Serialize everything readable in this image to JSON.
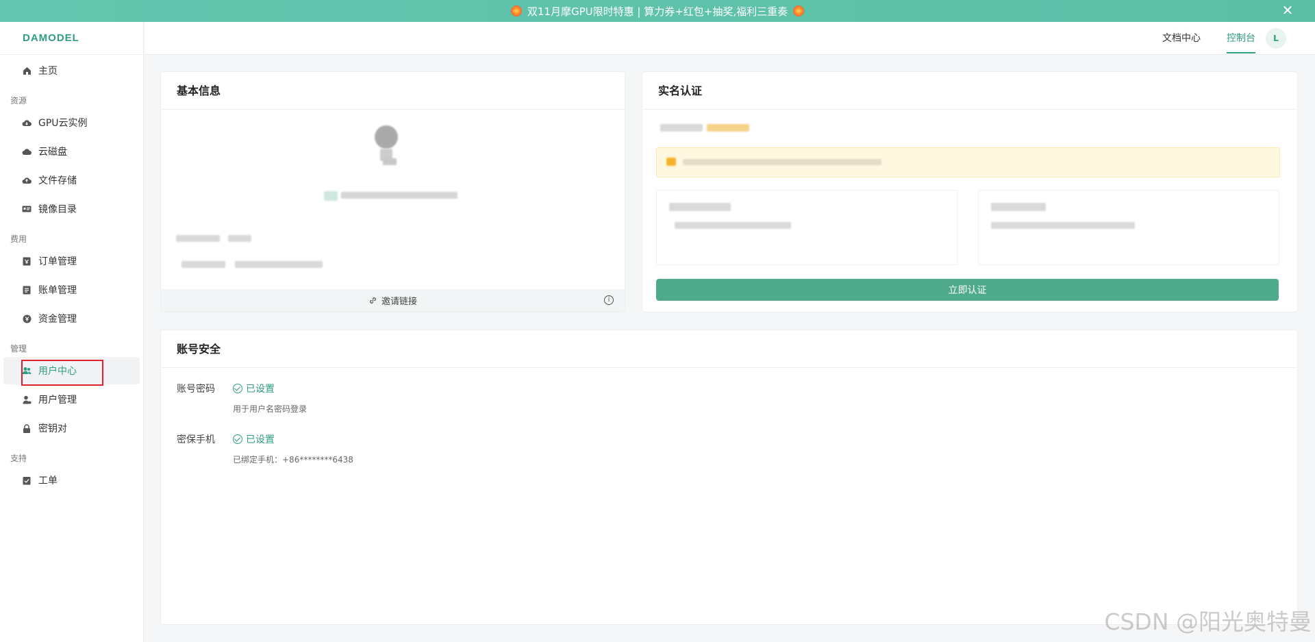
{
  "banner": {
    "text": "双11月摩GPU限时特惠 | 算力券+红包+抽奖,福利三重奏",
    "close_glyph": "✕"
  },
  "brand": {
    "logo": "DAMODEL"
  },
  "sidebar": {
    "home": "主页",
    "groups": [
      {
        "label": "资源",
        "items": [
          "GPU云实例",
          "云磁盘",
          "文件存储",
          "镜像目录"
        ]
      },
      {
        "label": "费用",
        "items": [
          "订单管理",
          "账单管理",
          "资金管理"
        ]
      },
      {
        "label": "管理",
        "items": [
          "用户中心",
          "用户管理",
          "密钥对"
        ]
      },
      {
        "label": "支持",
        "items": [
          "工单"
        ]
      }
    ],
    "active_item": "用户中心"
  },
  "topbar": {
    "docs": "文档中心",
    "console": "控制台",
    "avatar_letter": "L"
  },
  "basic_info": {
    "title": "基本信息",
    "invite_link": "邀请链接",
    "info_icon": "i"
  },
  "real_name": {
    "title": "实名认证",
    "button": "立即认证"
  },
  "security": {
    "title": "账号安全",
    "rows": [
      {
        "label": "账号密码",
        "status": "已设置",
        "desc": "用于用户名密码登录"
      },
      {
        "label": "密保手机",
        "status": "已设置",
        "desc": "已绑定手机：+86********6438"
      }
    ]
  },
  "watermark": "CSDN @阳光奥特曼",
  "colors": {
    "brand": "#2f9c83",
    "button": "#4eaa8b",
    "banner": "#5fc3aa",
    "highlight": "#e0202b"
  }
}
